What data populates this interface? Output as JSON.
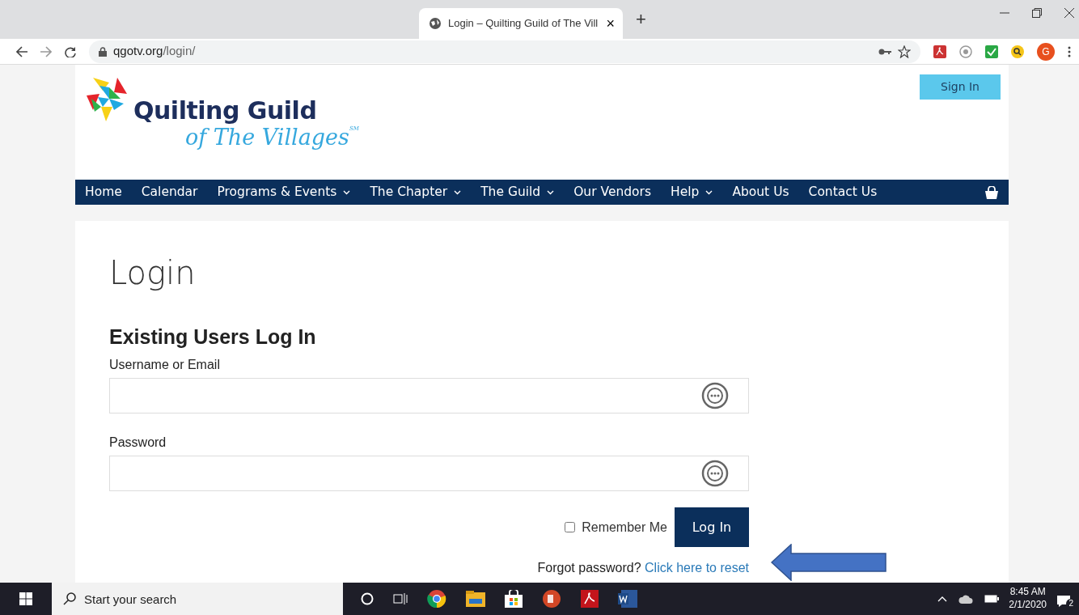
{
  "browser": {
    "tab_title": "Login – Quilting Guild of The Vill",
    "tab_close": "×",
    "new_tab": "+",
    "url_host": "qgotv.org",
    "url_path": "/login/",
    "profile": "G"
  },
  "header": {
    "logo_line1": "Quilting Guild",
    "logo_line2": "of The Villages",
    "logo_mark": "SM",
    "sign_in": "Sign In"
  },
  "nav": [
    {
      "label": "Home",
      "dropdown": false
    },
    {
      "label": "Calendar",
      "dropdown": false
    },
    {
      "label": "Programs & Events",
      "dropdown": true
    },
    {
      "label": "The Chapter",
      "dropdown": true
    },
    {
      "label": "The Guild",
      "dropdown": true
    },
    {
      "label": "Our Vendors",
      "dropdown": false
    },
    {
      "label": "Help",
      "dropdown": true
    },
    {
      "label": "About Us",
      "dropdown": false
    },
    {
      "label": "Contact Us",
      "dropdown": false
    }
  ],
  "page": {
    "heading": "Login",
    "form_title": "Existing Users Log In",
    "fields": [
      {
        "label": "Username or Email"
      },
      {
        "label": "Password"
      }
    ],
    "remember": {
      "label": "Remember Me",
      "checked": false
    },
    "login_button": "Log In",
    "forgot_text": "Forgot password?",
    "forgot_link": "Click here to reset"
  },
  "taskbar": {
    "search_placeholder": "Start your search",
    "time": "8:45 AM",
    "date": "2/1/2020",
    "notifications": "2"
  }
}
